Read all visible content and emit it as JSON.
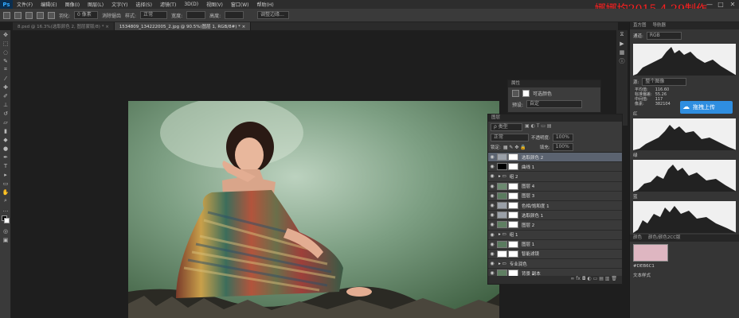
{
  "app": {
    "logo": "Ps"
  },
  "menu": [
    "文件(F)",
    "编辑(E)",
    "图像(I)",
    "图层(L)",
    "文字(Y)",
    "选择(S)",
    "滤镜(T)",
    "3D(D)",
    "视图(V)",
    "窗口(W)",
    "帮助(H)"
  ],
  "watermark": "娜娜均2015.4.29制作",
  "window_controls": [
    "—",
    "□",
    "✕"
  ],
  "options": {
    "feather_label": "羽化:",
    "feather_value": "0 像素",
    "antialias_label": "消除锯齿",
    "style_label": "样式:",
    "style_value": "正常",
    "width_label": "宽度:",
    "height_label": "高度:",
    "refine_label": "调整边缘..."
  },
  "tabs": [
    {
      "label": "8.psd @ 16.3%(选取颜色 2, 图层蒙版/8) * ×",
      "active": false
    },
    {
      "label": "1534809_134222005_2.jpg @ 90.5%(图层 1, RGB/8#) * ×",
      "active": true
    }
  ],
  "adjustments": {
    "title": "属性",
    "name": "可选颜色",
    "preset_label": "预设:",
    "preset_value": "自定"
  },
  "layers_panel": {
    "title": "图层",
    "kind_value": "ρ 类型",
    "blend_value": "正常",
    "opacity_label": "不透明度:",
    "opacity_value": "100%",
    "lock_label": "锁定:",
    "fill_label": "填充:",
    "fill_value": "100%",
    "rows": [
      {
        "name": "选取颜色 2",
        "highlighted": true,
        "thumb": "#9aa0a8"
      },
      {
        "name": "曲线 1",
        "highlighted": false,
        "thumb": "#000000"
      },
      {
        "name": "组 2",
        "highlighted": false,
        "thumb": ""
      },
      {
        "name": "图层 4",
        "highlighted": false,
        "thumb": "#6c8a70"
      },
      {
        "name": "图层 3",
        "highlighted": false,
        "thumb": "#5a7b5f"
      },
      {
        "name": "色相/饱和度 1",
        "highlighted": false,
        "thumb": "#9aa0a8"
      },
      {
        "name": "选取颜色 1",
        "highlighted": false,
        "thumb": "#9aa0a8"
      },
      {
        "name": "图层 2",
        "highlighted": false,
        "thumb": "#5f7f62"
      },
      {
        "name": "组 1",
        "highlighted": false,
        "thumb": ""
      },
      {
        "name": "图层 1",
        "highlighted": false,
        "thumb": "#5a7b5f"
      },
      {
        "name": "智能滤镜",
        "highlighted": false,
        "thumb": "#ffffff"
      },
      {
        "name": "专业润色",
        "highlighted": false,
        "thumb": ""
      },
      {
        "name": "背景 副本",
        "highlighted": false,
        "thumb": "#5f7f62"
      }
    ]
  },
  "histogram": {
    "tabs": [
      "直方图",
      "导航器"
    ],
    "channel_label": "通道:",
    "channel_value": "RGB",
    "source_label": "源:",
    "source_value": "整个图像",
    "stats_labels": [
      "平均值:",
      "标准偏差:",
      "中间值:",
      "像素:"
    ],
    "stats_values": [
      "116.60",
      "55.26",
      "117",
      "382104"
    ],
    "red_label": "红",
    "green_label": "绿",
    "blue_label": "蓝"
  },
  "upload_label": "拖拽上传",
  "color_panel": {
    "title": "颜色",
    "tab2": "颜色/颜色2CC版",
    "hex": "#DEB6C1",
    "swatch": "#deb6c1",
    "text_style_label": "文本样式"
  },
  "colors": {
    "accent": "#2f8ee0",
    "watermark": "#ff1f1f",
    "highlight": "#5b6370"
  }
}
